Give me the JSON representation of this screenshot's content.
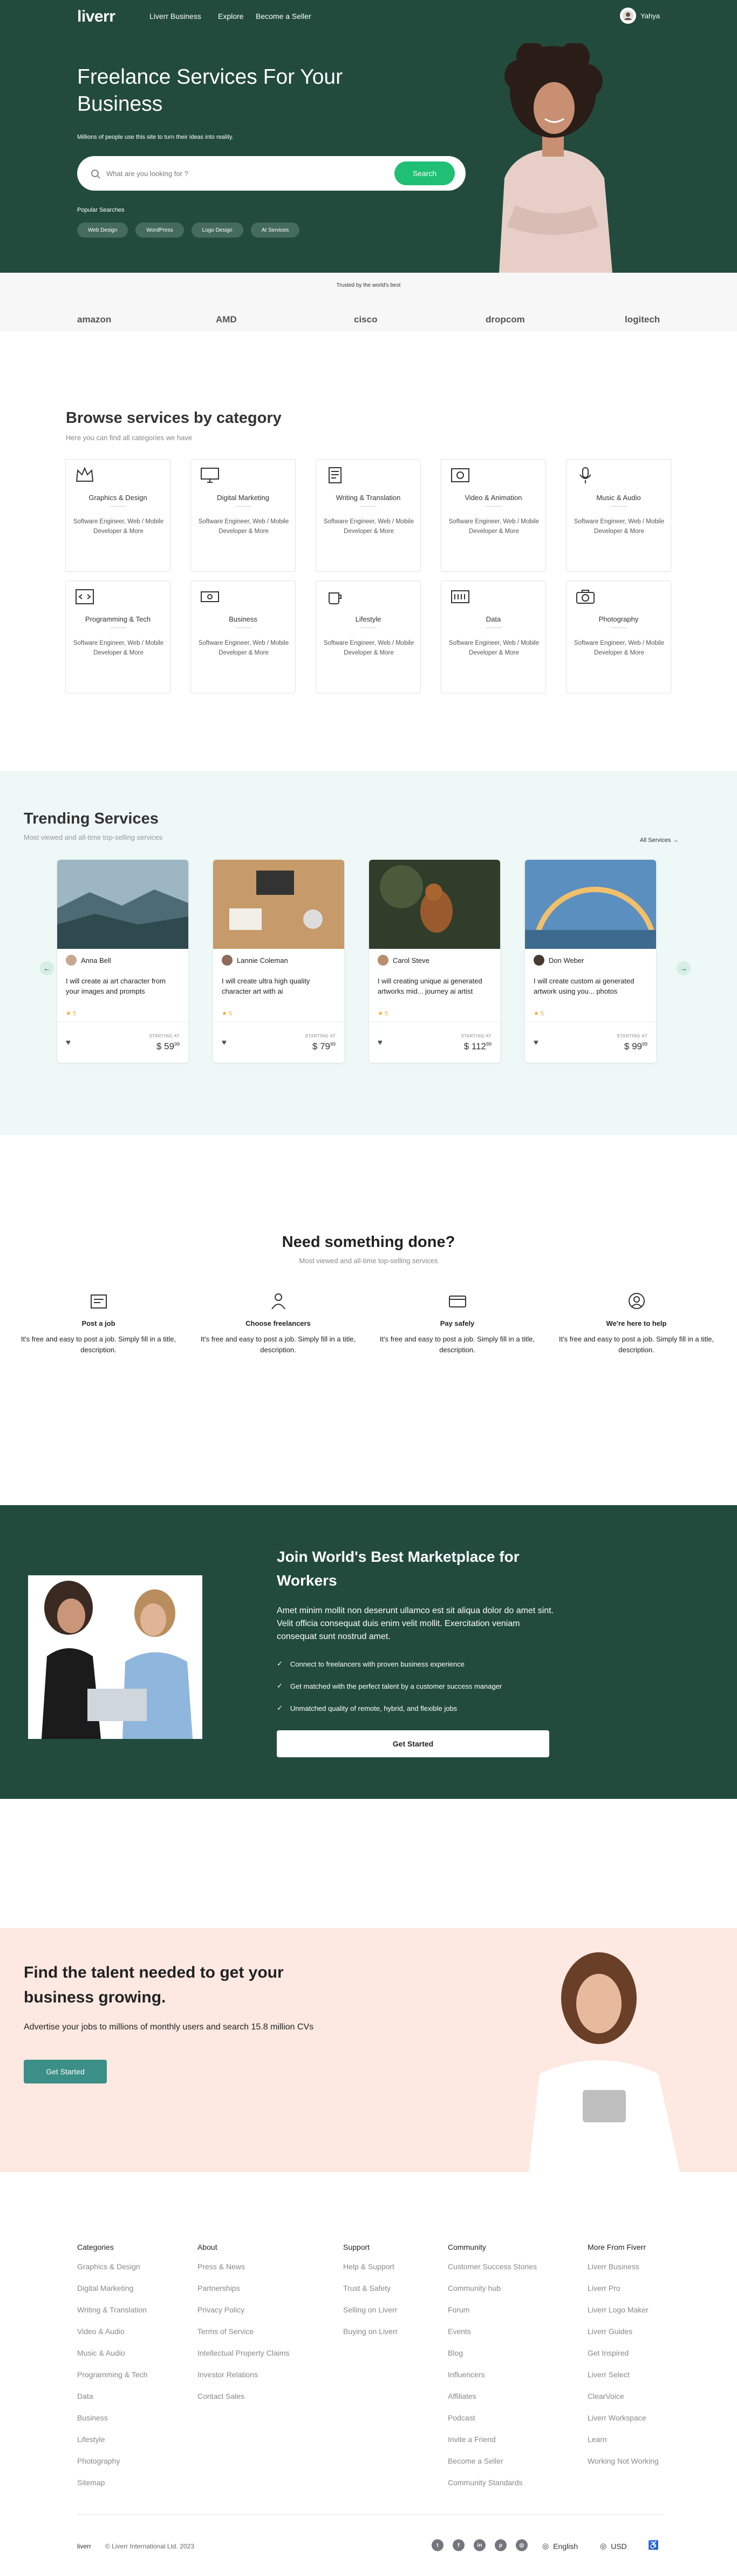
{
  "nav": {
    "logo": "liverr",
    "links": [
      "Liverr Business",
      "Explore",
      "Become a Seller"
    ],
    "user_name": "Yahya"
  },
  "hero": {
    "title": "Freelance Services For Your Business",
    "subtitle": "Millions of people use this site to turn their ideas into reality.",
    "search_placeholder": "What are you looking for ?",
    "search_button": "Search",
    "popular_label": "Popular Searches",
    "popular": [
      "Web Design",
      "WordPress",
      "Logo Design",
      "AI Services"
    ]
  },
  "trust": {
    "label": "Trusted by the world's best",
    "brands": [
      "amazon",
      "AMD",
      "cisco",
      "dropcom",
      "logitech"
    ]
  },
  "categories": {
    "title": "Browse services by category",
    "subtitle": "Here you can find all categories we have",
    "items": [
      {
        "name": "Graphics & Design",
        "desc": "Software Engineer, Web / Mobile Developer & More",
        "icon": "crown-icon"
      },
      {
        "name": "Digital Marketing",
        "desc": "Software Engineer, Web / Mobile Developer & More",
        "icon": "monitor-icon"
      },
      {
        "name": "Writing & Translation",
        "desc": "Software Engineer, Web / Mobile Developer & More",
        "icon": "document-icon"
      },
      {
        "name": "Video & Animation",
        "desc": "Software Engineer, Web / Mobile Developer & More",
        "icon": "film-icon"
      },
      {
        "name": "Music & Audio",
        "desc": "Software Engineer, Web / Mobile Developer & More",
        "icon": "microphone-icon"
      },
      {
        "name": "Programming & Tech",
        "desc": "Software Engineer, Web / Mobile Developer & More",
        "icon": "code-icon"
      },
      {
        "name": "Business",
        "desc": "Software Engineer, Web / Mobile Developer & More",
        "icon": "money-icon"
      },
      {
        "name": "Lifestyle",
        "desc": "Software Engineer, Web / Mobile Developer & More",
        "icon": "coffee-icon"
      },
      {
        "name": "Data",
        "desc": "Software Engineer, Web / Mobile Developer & More",
        "icon": "database-icon"
      },
      {
        "name": "Photography",
        "desc": "Software Engineer, Web / Mobile Developer & More",
        "icon": "camera-icon"
      }
    ]
  },
  "trending": {
    "title": "Trending Services",
    "subtitle": "Most viewed and all-time top-selling services",
    "all_link": "All Services",
    "starting_label": "STARTING AT",
    "cards": [
      {
        "seller": "Anna Bell",
        "desc": "I will create ai art character from your images and prompts",
        "rating": "★ 5",
        "price": "$ 59",
        "cents": "99"
      },
      {
        "seller": "Lannie Coleman",
        "desc": "I will create ultra high quality character art with ai",
        "rating": "★ 5",
        "price": "$ 79",
        "cents": "99"
      },
      {
        "seller": "Carol Steve",
        "desc": "I will creating unique ai generated artworks mid... journey ai artist",
        "rating": "★ 5",
        "price": "$ 112",
        "cents": "99"
      },
      {
        "seller": "Don Weber",
        "desc": "I will create custom ai generated artwork using you... photos",
        "rating": "★ 5",
        "price": "$ 99",
        "cents": "99"
      }
    ]
  },
  "need": {
    "title": "Need something done?",
    "subtitle": "Most viewed and all-time top-selling services",
    "items": [
      {
        "name": "Post a job",
        "desc": "It's free and easy to post a job. Simply fill in a title, description."
      },
      {
        "name": "Choose freelancers",
        "desc": "It's free and easy to post a job. Simply fill in a title, description."
      },
      {
        "name": "Pay safely",
        "desc": "It's free and easy to post a job. Simply fill in a title, description."
      },
      {
        "name": "We're here to help",
        "desc": "It's free and easy to post a job. Simply fill in a title, description."
      }
    ]
  },
  "join": {
    "title": "Join World's Best Marketplace for Workers",
    "body": "Amet minim mollit non deserunt ullamco est sit aliqua dolor do amet sint. Velit officia consequat duis enim velit mollit. Exercitation veniam consequat sunt nostrud amet.",
    "items": [
      "Connect to freelancers with proven business experience",
      "Get matched with the perfect talent by a customer success manager",
      "Unmatched quality of remote, hybrid, and flexible jobs"
    ],
    "button": "Get Started"
  },
  "talent": {
    "title": "Find the talent needed to get your business growing.",
    "subtitle": "Advertise your jobs to millions of monthly users and search 15.8 million CVs",
    "button": "Get Started"
  },
  "footer": {
    "columns": [
      {
        "head": "Categories",
        "links": [
          "Graphics & Design",
          "Digital Marketing",
          "Writing & Translation",
          "Video & Audio",
          "Music & Audio",
          "Programming & Tech",
          "Data",
          "Business",
          "Lifestyle",
          "Photography",
          "Sitemap"
        ]
      },
      {
        "head": "About",
        "links": [
          "Press & News",
          "Partnerships",
          "Privacy Policy",
          "Terms of Service",
          "Intellectual Property Claims",
          "Investor Relations",
          "Contact Sales"
        ]
      },
      {
        "head": "Support",
        "links": [
          "Help & Support",
          "Trust & Safety",
          "Selling on Liverr",
          "Buying on Liverr"
        ]
      },
      {
        "head": "Community",
        "links": [
          "Customer Success Stories",
          "Community hub",
          "Forum",
          "Events",
          "Blog",
          "Influencers",
          "Affiliates",
          "Podcast",
          "Invite a Friend",
          "Become a Seller",
          "Community Standards"
        ]
      },
      {
        "head": "More From Fiverr",
        "links": [
          "Liverr Business",
          "Liverr Pro",
          "Liverr Logo Maker",
          "Liverr Guides",
          "Get Inspired",
          "Liverr Select",
          "ClearVoice",
          "Liverr Workspace",
          "Learn",
          "Working Not Working"
        ]
      }
    ],
    "brand": "liverr",
    "copyright": "© Liverr International Ltd. 2023",
    "language": "English",
    "currency": "USD"
  }
}
